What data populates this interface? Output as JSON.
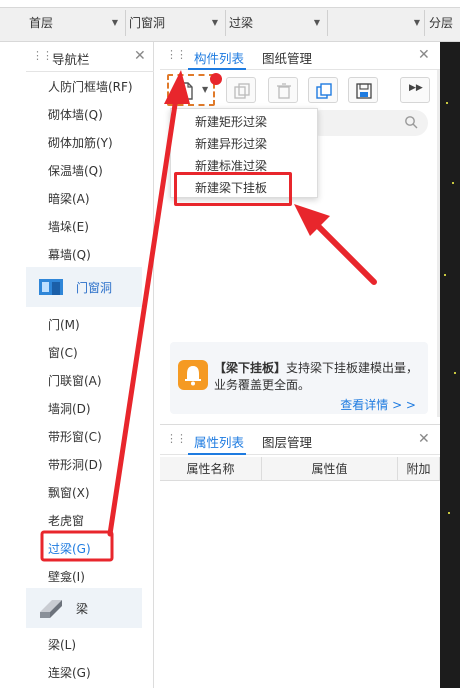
{
  "toolbar": {
    "floor_select": "首层",
    "category_select": "门窗洞",
    "type_select": "过梁",
    "extra_select": "",
    "partial_label": "分层"
  },
  "nav": {
    "title": "导航栏",
    "items_top": [
      "人防门框墙(RF)",
      "砌体墙(Q)",
      "砌体加筋(Y)",
      "保温墙(Q)",
      "暗梁(A)",
      "墙垛(E)",
      "幕墙(Q)"
    ],
    "category_door": "门窗洞",
    "items_door": [
      "门(M)",
      "窗(C)",
      "门联窗(A)",
      "墙洞(D)",
      "带形窗(C)",
      "带形洞(D)",
      "飘窗(X)",
      "老虎窗",
      "过梁(G)",
      "壁龛(I)"
    ],
    "category_beam": "梁",
    "items_beam": [
      "梁(L)",
      "连梁(G)"
    ]
  },
  "component_panel": {
    "tab_active": "构件列表",
    "tab_other": "图纸管理"
  },
  "new_menu": {
    "items": [
      "新建矩形过梁",
      "新建异形过梁",
      "新建标准过梁",
      "新建梁下挂板"
    ]
  },
  "promo": {
    "bold": "【梁下挂板】",
    "text": "支持梁下挂板建模出量，业务覆盖更全面。",
    "link": "查看详情 > >"
  },
  "property_panel": {
    "tab_active": "属性列表",
    "tab_other": "图层管理",
    "columns": [
      "属性名称",
      "属性值",
      "附加"
    ]
  },
  "colors": {
    "accent": "#1e7be0",
    "annotation": "#e8262c",
    "highlight_dashed": "#e07a2a",
    "promo_icon": "#f59a23"
  }
}
